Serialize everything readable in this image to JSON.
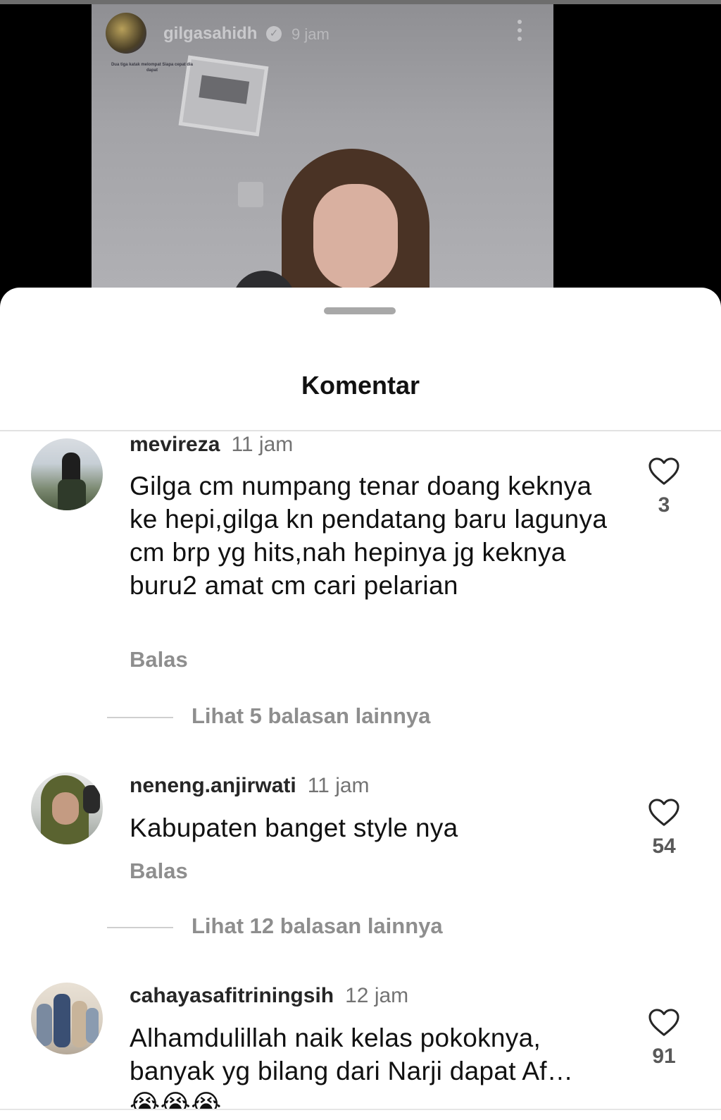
{
  "story": {
    "username": "gilgasahidh",
    "time": "9 jam",
    "caption": "Dua tiga katak melompat Siapa cepat dia dapat"
  },
  "sheet": {
    "title": "Komentar"
  },
  "comments": [
    {
      "username": "mevireza",
      "time": "11 jam",
      "text": "Gilga cm numpang tenar doang keknya ke hepi,gilga kn pendatang baru lagunya cm brp yg hits,nah hepinya jg keknya buru2 amat cm cari pelarian",
      "reply_label": "Balas",
      "likes": "3",
      "more_replies": "Lihat 5 balasan lainnya"
    },
    {
      "username": "neneng.anjirwati",
      "time": "11 jam",
      "text": "Kabupaten banget style nya",
      "reply_label": "Balas",
      "likes": "54",
      "more_replies": "Lihat 12 balasan lainnya"
    },
    {
      "username": "cahayasafitriningsih",
      "time": "12 jam",
      "text": "Alhamdulillah naik kelas pokoknya, banyak yg bilang dari Narji dapat Af… 😭😭😭",
      "likes": "91"
    }
  ],
  "icons": {
    "like": "heart-outline-icon",
    "more": "more-vertical-icon",
    "verified": "verified-badge-icon"
  }
}
